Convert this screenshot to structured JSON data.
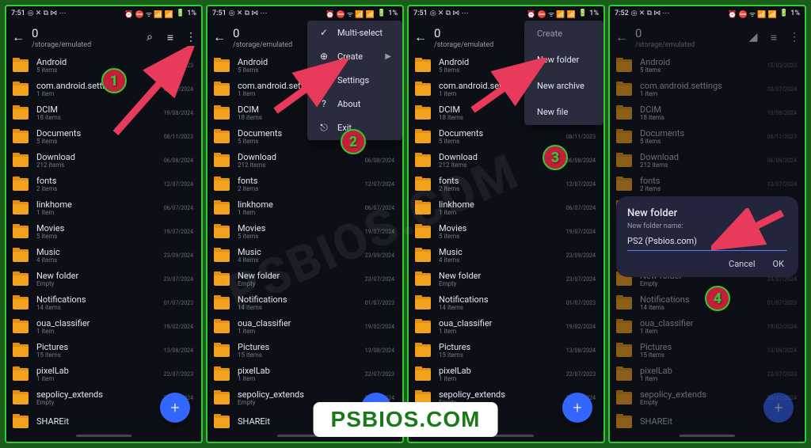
{
  "global": {
    "status": {
      "time_a": "7:51",
      "time_b": "7:52",
      "battery": "1%",
      "icons_left": "◎ ✕ ⧉ ⋈ ⋯",
      "icons_right": "⏰ ⛔ ᯤ 📶 📶"
    },
    "appbar": {
      "title": "0",
      "path": "/storage/emulated",
      "back": "←"
    },
    "watermark": "PSBIOS.COM",
    "footer": "PSBIOS.COM"
  },
  "folders": [
    {
      "name": "Android",
      "sub": "5 items",
      "date": "15/03/2023"
    },
    {
      "name": "com.android.settings",
      "sub": "1 item",
      "date": "02/07/2024"
    },
    {
      "name": "DCIM",
      "sub": "18 items",
      "date": "19/08/2024"
    },
    {
      "name": "Documents",
      "sub": "5 items",
      "date": "08/11/2023"
    },
    {
      "name": "Download",
      "sub": "212 items",
      "date": "06/08/2024"
    },
    {
      "name": "fonts",
      "sub": "2 items",
      "date": "12/07/2024"
    },
    {
      "name": "linkhome",
      "sub": "1 item",
      "date": "06/07/2024"
    },
    {
      "name": "Movies",
      "sub": "5 items",
      "date": "19/07/2024"
    },
    {
      "name": "Music",
      "sub": "4 items",
      "date": "23/09/2024"
    },
    {
      "name": "New folder",
      "sub": "Empty",
      "date": "23/07/2024"
    },
    {
      "name": "Notifications",
      "sub": "14 items",
      "date": "01/07/2023"
    },
    {
      "name": "oua_classifier",
      "sub": "1 item",
      "date": "19/02/2024"
    },
    {
      "name": "Pictures",
      "sub": "15 items",
      "date": "13/08/2024"
    },
    {
      "name": "pixelLab",
      "sub": "1 item",
      "date": "22/07/2023"
    },
    {
      "name": "sepolicy_extends",
      "sub": "Empty",
      "date": "30/11/2024"
    },
    {
      "name": "SHAREit",
      "sub": "",
      "date": ""
    }
  ],
  "menu_main": [
    {
      "icon": "✓",
      "label": "Multi-select",
      "arrow": ""
    },
    {
      "icon": "⊕",
      "label": "Create",
      "arrow": "▶"
    },
    {
      "icon": "⚙",
      "label": "Settings",
      "arrow": ""
    },
    {
      "icon": "?",
      "label": "About",
      "arrow": ""
    },
    {
      "icon": "⎋",
      "label": "Exit",
      "arrow": ""
    }
  ],
  "menu_create": [
    {
      "label": "Create"
    },
    {
      "label": "New folder"
    },
    {
      "label": "New archive"
    },
    {
      "label": "New file"
    }
  ],
  "dialog": {
    "title": "New folder",
    "label": "New folder name:",
    "value": "PS2 (Psbios.com)",
    "cancel": "Cancel",
    "ok": "OK"
  },
  "steps": {
    "s1": "1",
    "s2": "2",
    "s3": "3",
    "s4": "4"
  },
  "icons": {
    "search": "⌕",
    "list": "≡",
    "kebab": "⋮",
    "plus": "+",
    "signal": "◢"
  }
}
